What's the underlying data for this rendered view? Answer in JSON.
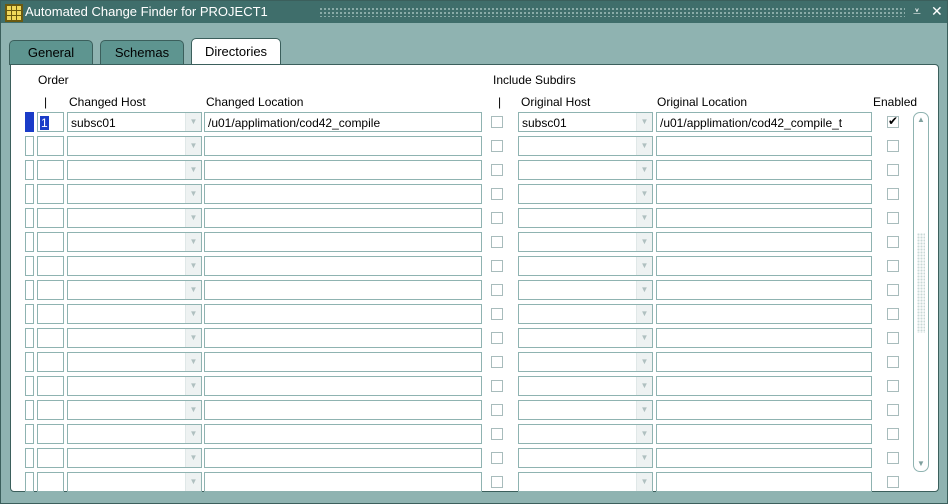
{
  "window": {
    "title": "Automated Change Finder for PROJECT1",
    "min_glyph": "⩡",
    "close_glyph": "✕"
  },
  "tabs": [
    {
      "label": "General",
      "active": false
    },
    {
      "label": "Schemas",
      "active": false
    },
    {
      "label": "Directories",
      "active": true
    }
  ],
  "headers": {
    "order": "Order",
    "order_sub": "|",
    "changed_host": "Changed Host",
    "changed_location": "Changed Location",
    "include_subdirs": "Include Subdirs",
    "include_sub": "|",
    "original_host": "Original Host",
    "original_location": "Original Location",
    "enabled": "Enabled"
  },
  "rows": [
    {
      "order": "1",
      "changed_host": "subsc01",
      "changed_location": "/u01/applimation/cod42_compile",
      "include_subdirs": false,
      "original_host": "subsc01",
      "original_location": "/u01/applimation/cod42_compile_t",
      "enabled": true
    },
    {
      "order": "",
      "changed_host": "",
      "changed_location": "",
      "include_subdirs": false,
      "original_host": "",
      "original_location": "",
      "enabled": false
    },
    {
      "order": "",
      "changed_host": "",
      "changed_location": "",
      "include_subdirs": false,
      "original_host": "",
      "original_location": "",
      "enabled": false
    },
    {
      "order": "",
      "changed_host": "",
      "changed_location": "",
      "include_subdirs": false,
      "original_host": "",
      "original_location": "",
      "enabled": false
    },
    {
      "order": "",
      "changed_host": "",
      "changed_location": "",
      "include_subdirs": false,
      "original_host": "",
      "original_location": "",
      "enabled": false
    },
    {
      "order": "",
      "changed_host": "",
      "changed_location": "",
      "include_subdirs": false,
      "original_host": "",
      "original_location": "",
      "enabled": false
    },
    {
      "order": "",
      "changed_host": "",
      "changed_location": "",
      "include_subdirs": false,
      "original_host": "",
      "original_location": "",
      "enabled": false
    },
    {
      "order": "",
      "changed_host": "",
      "changed_location": "",
      "include_subdirs": false,
      "original_host": "",
      "original_location": "",
      "enabled": false
    },
    {
      "order": "",
      "changed_host": "",
      "changed_location": "",
      "include_subdirs": false,
      "original_host": "",
      "original_location": "",
      "enabled": false
    },
    {
      "order": "",
      "changed_host": "",
      "changed_location": "",
      "include_subdirs": false,
      "original_host": "",
      "original_location": "",
      "enabled": false
    },
    {
      "order": "",
      "changed_host": "",
      "changed_location": "",
      "include_subdirs": false,
      "original_host": "",
      "original_location": "",
      "enabled": false
    },
    {
      "order": "",
      "changed_host": "",
      "changed_location": "",
      "include_subdirs": false,
      "original_host": "",
      "original_location": "",
      "enabled": false
    },
    {
      "order": "",
      "changed_host": "",
      "changed_location": "",
      "include_subdirs": false,
      "original_host": "",
      "original_location": "",
      "enabled": false
    },
    {
      "order": "",
      "changed_host": "",
      "changed_location": "",
      "include_subdirs": false,
      "original_host": "",
      "original_location": "",
      "enabled": false
    },
    {
      "order": "",
      "changed_host": "",
      "changed_location": "",
      "include_subdirs": false,
      "original_host": "",
      "original_location": "",
      "enabled": false
    },
    {
      "order": "",
      "changed_host": "",
      "changed_location": "",
      "include_subdirs": false,
      "original_host": "",
      "original_location": "",
      "enabled": false
    }
  ],
  "colors": {
    "frame": "#8fb3b1",
    "titlebar": "#3f6e6b",
    "tab": "#5e9590",
    "selection": "#1a3cc8"
  }
}
